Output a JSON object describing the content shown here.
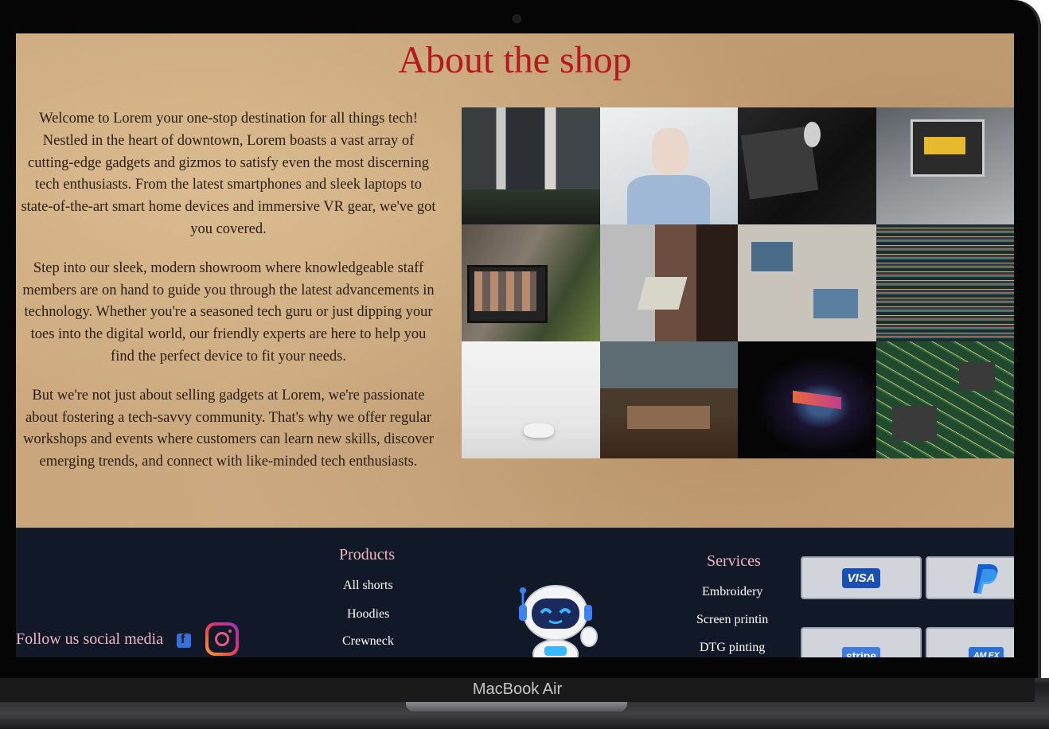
{
  "device": {
    "brand_label": "MacBook Air"
  },
  "about": {
    "title": "About the shop",
    "paragraphs": [
      "Welcome to Lorem your one-stop destination for all things tech! Nestled in the heart of downtown, Lorem boasts a vast array of cutting-edge gadgets and gizmos to satisfy even the most discerning tech enthusiasts. From the latest smartphones and sleek laptops to state-of-the-art smart home devices and immersive VR gear, we've got you covered.",
      "Step into our sleek, modern showroom where knowledgeable staff members are on hand to guide you through the latest advancements in technology. Whether you're a seasoned tech guru or just dipping your toes into the digital world, our friendly experts are here to help you find the perfect device to fit your needs.",
      "But we're not just about selling gadgets at Lorem, we're passionate about fostering a tech-savvy community. That's why we offer regular workshops and events where customers can learn new skills, discover emerging trends, and connect with like-minded tech enthusiasts."
    ],
    "gallery_count": 12
  },
  "footer": {
    "social_label": "Follow us social media",
    "social_icons": [
      "facebook-icon",
      "instagram-icon"
    ],
    "products": {
      "title": "Products",
      "links": [
        "All shorts",
        "Hoodies",
        "Crewneck"
      ]
    },
    "services": {
      "title": "Services",
      "links": [
        "Embroidery",
        "Screen printin",
        "DTG pinting"
      ]
    },
    "payments": {
      "visa": "VISA",
      "paypal": "paypal-icon",
      "stripe": "stripe",
      "amex": "AM EX"
    }
  },
  "colors": {
    "title_red": "#b3191f",
    "footer_bg": "#111827",
    "footer_heading_pink": "#f4b6c2",
    "parchment": "#c9a47a"
  }
}
